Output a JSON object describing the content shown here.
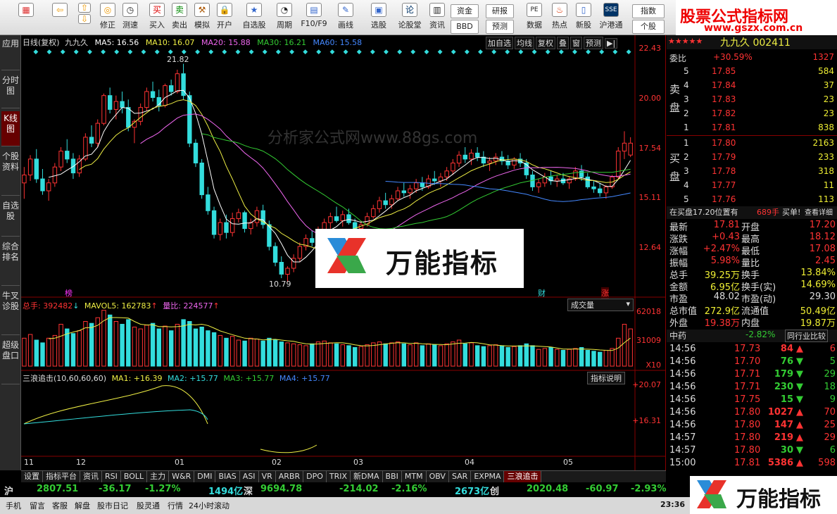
{
  "toolbar": {
    "items": [
      "买入",
      "卖出",
      "模拟",
      "开户",
      "自选股",
      "周期",
      "F10/F9",
      "画线",
      "选股",
      "论股堂",
      "资讯",
      "数据",
      "热点",
      "新股",
      "沪港通",
      "修正",
      "测速"
    ],
    "small": [
      "资金",
      "研报",
      "BBD",
      "预测",
      "指数",
      "个股"
    ]
  },
  "brand": {
    "title": "股票公式指标网",
    "url": "www.gszx.com.cn"
  },
  "lefttabs": [
    "应用",
    "分时图",
    "K线图",
    "个股资料",
    "自选股",
    "综合排名",
    "牛叉诊股",
    "超级盘口"
  ],
  "chart": {
    "title": "日线(复权)",
    "name": "九九久",
    "ma": [
      {
        "label": "MA5: 16.56",
        "color": "#ffffff"
      },
      {
        "label": "MA10: 16.07",
        "color": "#e8e84a"
      },
      {
        "label": "MA20: 15.88",
        "color": "#e060e0"
      },
      {
        "label": "MA30: 16.21",
        "color": "#30c030"
      },
      {
        "label": "MA60: 15.58",
        "color": "#3080ff"
      }
    ],
    "buttons": [
      "加自选",
      "均线",
      "复权",
      "叠",
      "窗",
      "预测"
    ],
    "yticks": [
      "22.43",
      "20.00",
      "17.54",
      "15.11",
      "12.64"
    ],
    "high_label": "21.82",
    "low_label": "10.79",
    "markers": [
      "榜",
      "财",
      "涨"
    ],
    "watermark": "分析家公式网www.88gs.com",
    "overlay": "万能指标"
  },
  "volume": {
    "total": "总手: 392482",
    "mavol": "MAVOL5: 162783",
    "ratio": "量比: 224577",
    "selector": "成交量",
    "yticks": [
      "62018",
      "31009"
    ],
    "unit": "X10"
  },
  "indicator": {
    "name": "三浪追击(10,60,60,60)",
    "ma1": "MA1: +16.39",
    "ma2": "MA2: +15.77",
    "ma3": "MA3: +15.77",
    "ma4": "MA4: +15.77",
    "button": "指标说明",
    "yticks": [
      "+20.07",
      "+16.31"
    ]
  },
  "xlabels": [
    "11",
    "12",
    "01",
    "02",
    "03",
    "04",
    "05"
  ],
  "tabs": [
    "设置",
    "指标平台",
    "资讯",
    "RSI",
    "BOLL",
    "主力",
    "W&R",
    "DMI",
    "BIAS",
    "ASI",
    "VR",
    "ARBR",
    "DPO",
    "TRIX",
    "新DMA",
    "BBI",
    "MTM",
    "OBV",
    "SAR",
    "EXPMA",
    "三浪追击"
  ],
  "right": {
    "stockname": "九九久 002411",
    "weibi_label": "委比",
    "weibi": "+30.59%",
    "weicha": "1327",
    "sell_label": "卖盘",
    "buy_label": "买盘",
    "asks": [
      [
        "5",
        "17.85",
        "584"
      ],
      [
        "4",
        "17.84",
        "37"
      ],
      [
        "3",
        "17.83",
        "23"
      ],
      [
        "2",
        "17.82",
        "23"
      ],
      [
        "1",
        "17.81",
        "838"
      ]
    ],
    "bids": [
      [
        "1",
        "17.80",
        "2163"
      ],
      [
        "2",
        "17.79",
        "233"
      ],
      [
        "3",
        "17.78",
        "318"
      ],
      [
        "4",
        "17.77",
        "11"
      ],
      [
        "5",
        "17.76",
        "113"
      ]
    ],
    "notice": "在买盘17.20位置有",
    "notice_val": "689手",
    "notice_btn1": "买单!",
    "notice_btn2": "查看详细",
    "stats": [
      [
        "最新",
        "17.81",
        "开盘",
        "17.20"
      ],
      [
        "涨跌",
        "+0.43",
        "最高",
        "18.12"
      ],
      [
        "涨幅",
        "+2.47%",
        "最低",
        "17.08"
      ],
      [
        "振幅",
        "5.98%",
        "量比",
        "2.45"
      ],
      [
        "总手",
        "39.25万",
        "换手",
        "13.84%"
      ],
      [
        "金额",
        "6.95亿",
        "换手(实)",
        "14.69%"
      ],
      [
        "市盈",
        "48.02",
        "市盈(动)",
        "29.30"
      ],
      [
        "总市值",
        "272.9亿",
        "流通值",
        "50.49亿"
      ],
      [
        "外盘",
        "19.38万",
        "内盘",
        "19.87万"
      ]
    ],
    "sector": "中药",
    "sector_chg": "-2.82%",
    "sector_btn": "同行业比较",
    "ticks": [
      [
        "14:56",
        "17.73",
        "84",
        "up",
        "6"
      ],
      [
        "14:56",
        "17.70",
        "76",
        "dn",
        "5"
      ],
      [
        "14:56",
        "17.71",
        "179",
        "dn",
        "29"
      ],
      [
        "14:56",
        "17.71",
        "230",
        "dn",
        "18"
      ],
      [
        "14:56",
        "17.75",
        "15",
        "dn",
        "9"
      ],
      [
        "14:56",
        "17.80",
        "1027",
        "up",
        "70"
      ],
      [
        "14:56",
        "17.80",
        "147",
        "up",
        "25"
      ],
      [
        "14:57",
        "17.80",
        "219",
        "up",
        "29"
      ],
      [
        "14:57",
        "17.80",
        "30",
        "dn",
        "6"
      ],
      [
        "15:00",
        "17.81",
        "5386",
        "up",
        "598"
      ]
    ]
  },
  "index": [
    {
      "label": "沪",
      "val": "2807.51",
      "chg": "-36.17",
      "pct": "-1.27%",
      "amt": "1494亿"
    },
    {
      "label": "深",
      "val": "9694.78",
      "chg": "-214.02",
      "pct": "-2.16%",
      "amt": "2673亿"
    },
    {
      "label": "创",
      "val": "2020.48",
      "chg": "-60.97",
      "pct": "-2.93%",
      "amt": ""
    }
  ],
  "status": {
    "items": [
      "手机",
      "留言",
      "客服",
      "解盘",
      "股市日记",
      "股灵通",
      "行情",
      "24小时滚动"
    ],
    "time": "23:36"
  },
  "wn2": "万能指标",
  "candles": [
    [
      15.8,
      16.6,
      15.0,
      16.2
    ],
    [
      16.2,
      17.2,
      15.9,
      17.0
    ],
    [
      17.0,
      17.5,
      15.8,
      16.0
    ],
    [
      16.0,
      16.5,
      15.2,
      15.4
    ],
    [
      15.4,
      16.0,
      14.9,
      15.8
    ],
    [
      15.8,
      16.8,
      15.6,
      16.6
    ],
    [
      16.6,
      17.6,
      16.4,
      17.4
    ],
    [
      17.4,
      18.0,
      16.8,
      17.0
    ],
    [
      17.0,
      17.3,
      16.0,
      16.3
    ],
    [
      16.3,
      17.2,
      16.1,
      17.0
    ],
    [
      17.0,
      18.3,
      16.9,
      18.1
    ],
    [
      18.1,
      18.7,
      17.6,
      17.8
    ],
    [
      17.8,
      19.0,
      17.6,
      18.8
    ],
    [
      18.8,
      20.3,
      18.7,
      20.2
    ],
    [
      20.2,
      20.6,
      19.3,
      19.5
    ],
    [
      19.5,
      20.2,
      19.0,
      19.9
    ],
    [
      19.9,
      20.4,
      19.3,
      19.6
    ],
    [
      19.6,
      20.0,
      18.4,
      18.6
    ],
    [
      18.6,
      19.0,
      17.8,
      18.9
    ],
    [
      18.9,
      19.8,
      18.7,
      19.6
    ],
    [
      19.6,
      20.6,
      19.4,
      20.4
    ],
    [
      20.4,
      20.9,
      19.9,
      20.1
    ],
    [
      20.1,
      20.5,
      19.4,
      19.7
    ],
    [
      19.7,
      20.8,
      19.6,
      20.7
    ],
    [
      20.7,
      21.0,
      20.2,
      20.4
    ],
    [
      20.4,
      21.5,
      20.3,
      21.3
    ],
    [
      21.3,
      21.8,
      20.0,
      20.2
    ],
    [
      20.2,
      20.4,
      17.6,
      17.8
    ],
    [
      17.8,
      18.0,
      16.6,
      16.8
    ],
    [
      16.8,
      17.0,
      15.0,
      15.2
    ],
    [
      15.2,
      15.6,
      14.2,
      14.4
    ],
    [
      14.4,
      14.6,
      13.0,
      13.2
    ],
    [
      13.2,
      14.0,
      12.9,
      13.8
    ],
    [
      13.8,
      14.2,
      13.0,
      13.3
    ],
    [
      13.3,
      14.3,
      13.1,
      14.0
    ],
    [
      14.0,
      14.5,
      13.8,
      14.3
    ],
    [
      14.3,
      14.4,
      13.3,
      13.5
    ],
    [
      13.5,
      14.0,
      13.2,
      13.8
    ],
    [
      13.8,
      14.6,
      13.6,
      14.4
    ],
    [
      14.4,
      14.7,
      13.5,
      13.7
    ],
    [
      13.7,
      13.9,
      12.4,
      12.6
    ],
    [
      12.6,
      12.8,
      11.6,
      11.8
    ],
    [
      11.8,
      12.1,
      11.0,
      11.2
    ],
    [
      11.2,
      11.6,
      10.8,
      11.5
    ],
    [
      11.5,
      12.2,
      11.3,
      12.0
    ],
    [
      12.0,
      12.8,
      11.8,
      12.6
    ],
    [
      12.6,
      13.2,
      12.4,
      13.0
    ],
    [
      13.0,
      13.4,
      12.6,
      12.8
    ],
    [
      12.8,
      13.6,
      12.7,
      13.4
    ],
    [
      13.4,
      14.0,
      13.1,
      13.8
    ],
    [
      13.8,
      14.3,
      13.5,
      14.1
    ],
    [
      14.1,
      14.6,
      13.8,
      13.9
    ],
    [
      13.9,
      14.4,
      13.6,
      14.2
    ],
    [
      14.2,
      14.5,
      13.7,
      13.8
    ],
    [
      13.8,
      14.0,
      13.3,
      13.5
    ],
    [
      13.5,
      13.9,
      13.2,
      13.7
    ],
    [
      13.7,
      14.3,
      13.6,
      14.1
    ],
    [
      14.1,
      14.7,
      14.0,
      14.5
    ],
    [
      14.5,
      15.1,
      14.3,
      14.9
    ],
    [
      14.9,
      15.3,
      14.5,
      14.7
    ],
    [
      14.7,
      15.2,
      14.5,
      15.0
    ],
    [
      15.0,
      15.6,
      14.9,
      15.4
    ],
    [
      15.4,
      15.8,
      15.1,
      15.3
    ],
    [
      15.3,
      15.7,
      15.0,
      15.5
    ],
    [
      15.5,
      16.0,
      15.3,
      15.8
    ],
    [
      15.8,
      16.1,
      15.4,
      15.6
    ],
    [
      15.6,
      16.2,
      15.5,
      16.0
    ],
    [
      16.0,
      16.4,
      15.7,
      15.9
    ],
    [
      15.9,
      16.3,
      15.6,
      16.1
    ],
    [
      16.1,
      16.6,
      15.9,
      16.4
    ],
    [
      16.4,
      17.0,
      16.2,
      16.8
    ],
    [
      16.8,
      17.4,
      16.6,
      17.2
    ],
    [
      17.2,
      17.6,
      16.8,
      17.0
    ],
    [
      17.0,
      17.5,
      16.7,
      17.3
    ],
    [
      17.3,
      17.6,
      16.9,
      17.1
    ],
    [
      17.1,
      17.4,
      16.6,
      16.8
    ],
    [
      16.8,
      17.1,
      16.4,
      16.9
    ],
    [
      16.9,
      17.3,
      16.7,
      17.1
    ],
    [
      17.1,
      17.4,
      16.7,
      16.9
    ],
    [
      16.9,
      17.2,
      16.5,
      16.7
    ],
    [
      16.7,
      17.1,
      16.5,
      17.0
    ],
    [
      17.0,
      17.3,
      16.6,
      16.8
    ],
    [
      16.8,
      17.0,
      16.0,
      16.2
    ],
    [
      16.2,
      16.4,
      15.4,
      15.6
    ],
    [
      15.6,
      16.0,
      15.3,
      15.8
    ],
    [
      15.8,
      16.3,
      15.6,
      16.1
    ],
    [
      16.1,
      16.4,
      15.7,
      15.9
    ],
    [
      15.9,
      16.2,
      15.6,
      16.0
    ],
    [
      16.0,
      16.3,
      15.7,
      15.8
    ],
    [
      15.8,
      16.1,
      15.5,
      16.0
    ],
    [
      16.0,
      16.6,
      15.9,
      16.4
    ],
    [
      16.4,
      16.7,
      15.9,
      16.1
    ],
    [
      16.1,
      16.3,
      15.5,
      15.6
    ],
    [
      15.6,
      15.9,
      15.3,
      15.5
    ],
    [
      15.5,
      15.8,
      15.1,
      15.3
    ],
    [
      15.3,
      15.7,
      15.0,
      15.6
    ],
    [
      15.6,
      16.2,
      15.5,
      16.1
    ],
    [
      16.1,
      17.6,
      16.0,
      17.4
    ],
    [
      17.4,
      18.4,
      17.0,
      17.8
    ],
    [
      17.2,
      18.1,
      17.1,
      17.8
    ]
  ],
  "volumes": [
    30,
    34,
    28,
    25,
    30,
    33,
    45,
    40,
    35,
    38,
    48,
    46,
    52,
    60,
    55,
    48,
    45,
    50,
    42,
    40,
    44,
    46,
    40,
    43,
    38,
    45,
    50,
    48,
    40,
    42,
    38,
    36,
    33,
    30,
    32,
    28,
    27,
    30,
    29,
    27,
    30,
    28,
    26,
    25,
    24,
    23,
    22,
    24,
    26,
    27,
    25,
    24,
    23,
    22,
    20,
    21,
    23,
    25,
    26,
    24,
    25,
    26,
    24,
    23,
    25,
    22,
    24,
    23,
    22,
    24,
    26,
    28,
    24,
    25,
    22,
    21,
    22,
    23,
    22,
    20,
    21,
    22,
    24,
    22,
    18,
    19,
    20,
    18,
    17,
    18,
    19,
    20,
    17,
    16,
    15,
    17,
    19,
    30,
    45,
    40
  ]
}
